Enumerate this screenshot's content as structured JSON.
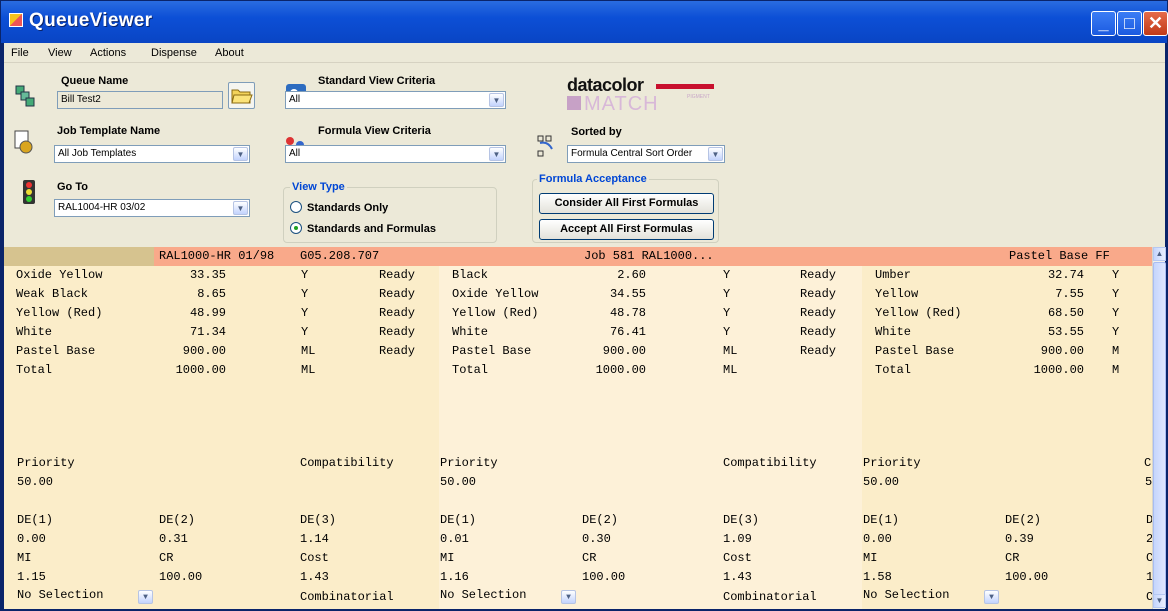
{
  "title": "QueueViewer",
  "menu": [
    "File",
    "View",
    "Actions",
    "Dispense",
    "About"
  ],
  "queue": {
    "label": "Queue Name",
    "value": "Bill Test2"
  },
  "template": {
    "label": "Job Template Name",
    "value": "All Job Templates"
  },
  "goto": {
    "label": "Go To",
    "value": "RAL1004-HR 03/02"
  },
  "std_view": {
    "label": "Standard View Criteria",
    "value": "All"
  },
  "formula_view": {
    "label": "Formula View Criteria",
    "value": "All"
  },
  "view_type": {
    "label": "View Type",
    "options": [
      "Standards Only",
      "Standards and Formulas"
    ],
    "selected": 1
  },
  "logo": {
    "brand": "datacolor",
    "product": "MATCH",
    "sub": "PIGMENT"
  },
  "sorted": {
    "label": "Sorted by",
    "value": "Formula Central Sort Order"
  },
  "acceptance": {
    "label": "Formula Acceptance",
    "consider": "Consider All First Formulas",
    "accept": "Accept All First Formulas"
  },
  "columns": [
    {
      "header": [
        "RAL1000-HR 01/98",
        "G05.208.707"
      ],
      "rows": [
        [
          "Oxide Yellow",
          "33.35",
          "Y",
          "Ready"
        ],
        [
          "Weak Black",
          "8.65",
          "Y",
          "Ready"
        ],
        [
          "Yellow (Red)",
          "48.99",
          "Y",
          "Ready"
        ],
        [
          "White",
          "71.34",
          "Y",
          "Ready"
        ],
        [
          "Pastel Base",
          "900.00",
          "ML",
          "Ready"
        ],
        [
          "Total",
          "1000.00",
          "ML",
          ""
        ]
      ],
      "priority": "50.00",
      "compat": "",
      "de": [
        "0.00",
        "0.31",
        "1.14"
      ],
      "mi": "1.15",
      "cr": "100.00",
      "cost": "1.43",
      "selection": "No Selection",
      "method": "Combinatorial"
    },
    {
      "header": [
        "",
        "Job 581 RAL1000..."
      ],
      "rows": [
        [
          "Black",
          "2.60",
          "Y",
          "Ready"
        ],
        [
          "Oxide Yellow",
          "34.55",
          "Y",
          "Ready"
        ],
        [
          "Yellow (Red)",
          "48.78",
          "Y",
          "Ready"
        ],
        [
          "White",
          "76.41",
          "Y",
          "Ready"
        ],
        [
          "Pastel Base",
          "900.00",
          "ML",
          "Ready"
        ],
        [
          "Total",
          "1000.00",
          "ML",
          ""
        ]
      ],
      "priority": "50.00",
      "compat": "",
      "de": [
        "0.01",
        "0.30",
        "1.09"
      ],
      "mi": "1.16",
      "cr": "100.00",
      "cost": "1.43",
      "selection": "No Selection",
      "method": "Combinatorial"
    },
    {
      "header": [
        "",
        "Pastel Base FF"
      ],
      "rows": [
        [
          "Umber",
          "32.74",
          "Y",
          ""
        ],
        [
          "Yellow",
          "7.55",
          "Y",
          ""
        ],
        [
          "Yellow (Red)",
          "68.50",
          "Y",
          ""
        ],
        [
          "White",
          "53.55",
          "Y",
          ""
        ],
        [
          "Pastel Base",
          "900.00",
          "M",
          ""
        ],
        [
          "Total",
          "1000.00",
          "M",
          ""
        ]
      ],
      "priority": "50.00",
      "compat": "5",
      "de": [
        "0.00",
        "0.39",
        "2"
      ],
      "mi": "1.58",
      "cr": "100.00",
      "cost": "1",
      "selection": "No Selection",
      "method": "C"
    }
  ],
  "labels": {
    "priority": "Priority",
    "compat": "Compatibility",
    "de1": "DE(1)",
    "de2": "DE(2)",
    "de3": "DE(3)",
    "mi": "MI",
    "cr": "CR",
    "cost": "Cost",
    "trunc_c": "C",
    "trunc_d": "D"
  },
  "colors": {
    "titlebar": "#0c4fd6",
    "grid_bg": "#fbedc9",
    "grid_alt": "#fdf1d8",
    "header": "#f9a98a"
  }
}
